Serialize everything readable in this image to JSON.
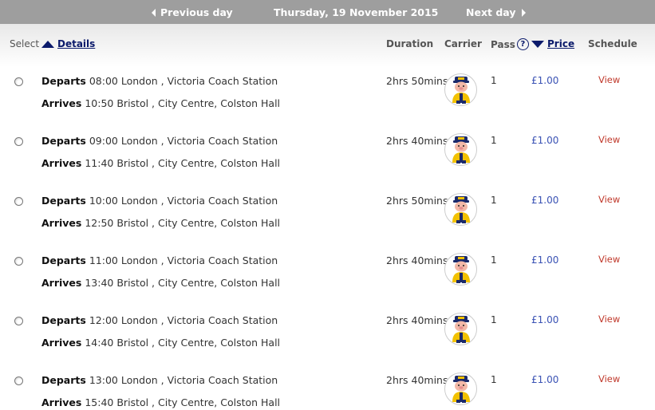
{
  "daybar": {
    "prev_label": "Previous day",
    "date": "Thursday, 19 November 2015",
    "next_label": "Next day"
  },
  "header": {
    "select": "Select",
    "details": "Details",
    "duration": "Duration",
    "carrier": "Carrier",
    "pass": "Pass",
    "help": "?",
    "price": "Price",
    "schedule": "Schedule"
  },
  "labels": {
    "departs": "Departs",
    "arrives": "Arrives",
    "view": "View"
  },
  "colors": {
    "accent": "#0b1a6b",
    "price": "#3a52b4",
    "view": "#c0392b",
    "daybar": "#9e9e9e"
  },
  "icons": {
    "carrier": "carrier-mascot-icon"
  },
  "journeys": [
    {
      "depart": "08:00 London , Victoria Coach Station",
      "arrive": "10:50 Bristol , City Centre, Colston Hall",
      "duration": "2hrs 50mins",
      "pass": "1",
      "price": "£1.00"
    },
    {
      "depart": "09:00 London , Victoria Coach Station",
      "arrive": "11:40 Bristol , City Centre, Colston Hall",
      "duration": "2hrs 40mins",
      "pass": "1",
      "price": "£1.00"
    },
    {
      "depart": "10:00 London , Victoria Coach Station",
      "arrive": "12:50 Bristol , City Centre, Colston Hall",
      "duration": "2hrs 50mins",
      "pass": "1",
      "price": "£1.00"
    },
    {
      "depart": "11:00 London , Victoria Coach Station",
      "arrive": "13:40 Bristol , City Centre, Colston Hall",
      "duration": "2hrs 40mins",
      "pass": "1",
      "price": "£1.00"
    },
    {
      "depart": "12:00 London , Victoria Coach Station",
      "arrive": "14:40 Bristol , City Centre, Colston Hall",
      "duration": "2hrs 40mins",
      "pass": "1",
      "price": "£1.00"
    },
    {
      "depart": "13:00 London , Victoria Coach Station",
      "arrive": "15:40 Bristol , City Centre, Colston Hall",
      "duration": "2hrs 40mins",
      "pass": "1",
      "price": "£1.00"
    }
  ]
}
